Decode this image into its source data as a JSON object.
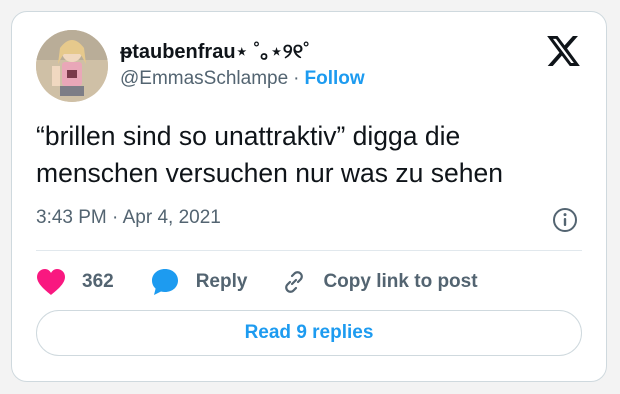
{
  "author": {
    "display_name": "ᵽtaubenfrau⋆ ˚｡⋆୨୧˚",
    "handle": "@EmmasSchlampe",
    "separator": "·",
    "follow_label": "Follow"
  },
  "tweet": {
    "text": "“brillen sind so unattraktiv” digga die menschen versuchen nur was zu sehen",
    "time": "3:43 PM",
    "date_separator": "·",
    "date": "Apr 4, 2021"
  },
  "actions": {
    "like_count": "362",
    "reply_label": "Reply",
    "copy_link_label": "Copy link to post"
  },
  "footer": {
    "read_replies_label": "Read 9 replies"
  },
  "icons": {
    "logo": "x-logo-icon",
    "info": "info-icon",
    "like": "heart-icon",
    "reply": "speech-bubble-icon",
    "copy": "link-icon"
  },
  "colors": {
    "accent": "#1d9bf0",
    "like": "#f91880",
    "text": "#0f1419",
    "muted": "#536471"
  }
}
